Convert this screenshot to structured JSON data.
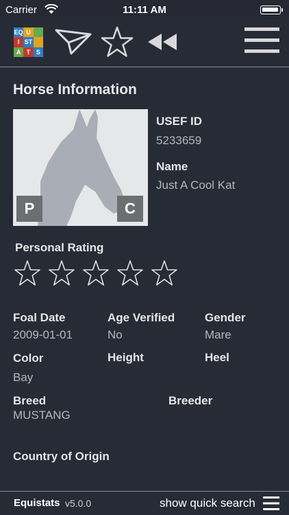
{
  "status_bar": {
    "carrier": "Carrier",
    "time": "11:11 AM"
  },
  "toolbar": {
    "logo_letters": [
      "EQ",
      "U",
      "",
      "I",
      "ST",
      "",
      "A",
      "T",
      "S"
    ],
    "logo_colors": [
      "#2f7fc1",
      "#e2a220",
      "#6aa84f",
      "#c0392b",
      "#2f7fc1",
      "#e2a220",
      "#6aa84f",
      "#c0392b",
      "#2f7fc1"
    ],
    "icons": [
      "send-icon",
      "star-icon",
      "rewind-icon",
      "menu-icon"
    ]
  },
  "main": {
    "title": "Horse Information",
    "photo": {
      "badge_left": "P",
      "badge_right": "C"
    },
    "usef_id": {
      "label": "USEF ID",
      "value": "5233659"
    },
    "name": {
      "label": "Name",
      "value": "Just A Cool Kat"
    },
    "rating": {
      "label": "Personal Rating",
      "stars": 0,
      "max": 5
    },
    "foal_date": {
      "label": "Foal Date",
      "value": "2009-01-01"
    },
    "age_verified": {
      "label": "Age Verified",
      "value": "No"
    },
    "gender": {
      "label": "Gender",
      "value": "Mare"
    },
    "color": {
      "label": "Color",
      "value": "Bay"
    },
    "height": {
      "label": "Height",
      "value": ""
    },
    "heel": {
      "label": "Heel",
      "value": ""
    },
    "breed": {
      "label": "Breed",
      "value": "MUSTANG"
    },
    "breeder": {
      "label": "Breeder",
      "value": ""
    },
    "country": {
      "label": "Country of Origin",
      "value": ""
    }
  },
  "bottom_bar": {
    "brand": "Equistats",
    "version": "v5.0.0",
    "quick_search": "show quick search"
  }
}
